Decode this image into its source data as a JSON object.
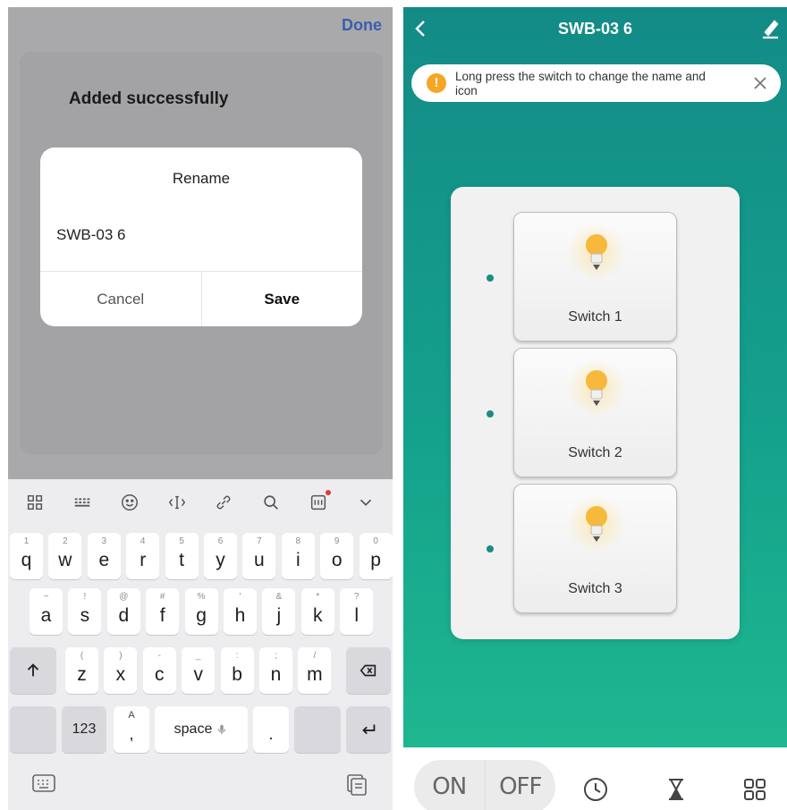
{
  "left": {
    "done_label": "Done",
    "added_title": "Added successfully",
    "rename": {
      "title": "Rename",
      "value": "SWB-03 6",
      "cancel_label": "Cancel",
      "save_label": "Save"
    },
    "toolbar_icons": [
      "grid-icon",
      "keyboard-layout-icon",
      "emoji-icon",
      "cursor-icon",
      "clipboard-link-icon",
      "search-icon",
      "sticker-icon",
      "collapse-icon"
    ],
    "keyboard": {
      "row1": [
        {
          "k": "q",
          "s": "1"
        },
        {
          "k": "w",
          "s": "2"
        },
        {
          "k": "e",
          "s": "3"
        },
        {
          "k": "r",
          "s": "4"
        },
        {
          "k": "t",
          "s": "5"
        },
        {
          "k": "y",
          "s": "6"
        },
        {
          "k": "u",
          "s": "7"
        },
        {
          "k": "i",
          "s": "8"
        },
        {
          "k": "o",
          "s": "9"
        },
        {
          "k": "p",
          "s": "0"
        }
      ],
      "row2": [
        {
          "k": "a",
          "s": "~"
        },
        {
          "k": "s",
          "s": "!"
        },
        {
          "k": "d",
          "s": "@"
        },
        {
          "k": "f",
          "s": "#"
        },
        {
          "k": "g",
          "s": "%"
        },
        {
          "k": "h",
          "s": "'"
        },
        {
          "k": "j",
          "s": "&"
        },
        {
          "k": "k",
          "s": "*"
        },
        {
          "k": "l",
          "s": "?"
        }
      ],
      "row3": [
        {
          "k": "z",
          "s": "("
        },
        {
          "k": "x",
          "s": ")"
        },
        {
          "k": "c",
          "s": "-"
        },
        {
          "k": "v",
          "s": "_"
        },
        {
          "k": "b",
          "s": ":"
        },
        {
          "k": "n",
          "s": ";"
        },
        {
          "k": "m",
          "s": "/"
        }
      ],
      "num_label": "123",
      "comma_label": ",",
      "comma_sub": "A",
      "space_label": "space",
      "period_label": "."
    }
  },
  "right": {
    "title": "SWB-03 6",
    "tip": {
      "icon_text": "!",
      "text": "Long press the switch to change the name and icon"
    },
    "switches": [
      {
        "label": "Switch 1"
      },
      {
        "label": "Switch 2"
      },
      {
        "label": "Switch 3"
      }
    ],
    "bottom": {
      "on_label": "ON",
      "off_label": "OFF",
      "icons": [
        "clock-icon",
        "hourglass-icon",
        "grid-icon"
      ]
    },
    "colors": {
      "accent": "#14a08c",
      "bulb": "#f6b93b",
      "indicator": "#1b8d84"
    }
  }
}
